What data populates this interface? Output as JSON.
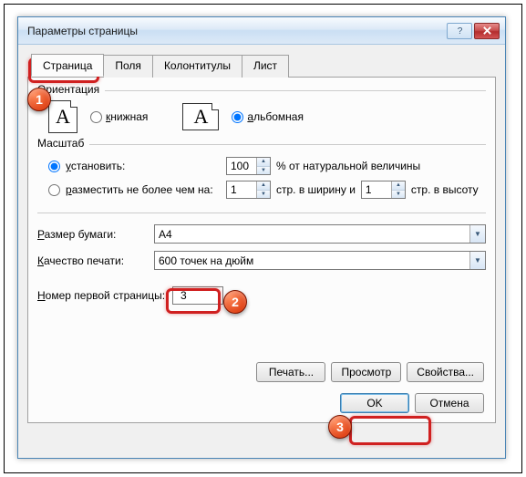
{
  "window": {
    "title": "Параметры страницы"
  },
  "tabs": [
    "Страница",
    "Поля",
    "Колонтитулы",
    "Лист"
  ],
  "orientation": {
    "legend": "Ориентация",
    "portrait": "книжная",
    "landscape": "альбомная",
    "selected": "landscape"
  },
  "scale": {
    "legend": "Масштаб",
    "set_label": "установить:",
    "set_value": "100",
    "set_suffix": "% от натуральной величины",
    "fit_label": "разместить не более чем на:",
    "fit_w": "1",
    "fit_mid": "стр. в ширину и",
    "fit_h": "1",
    "fit_suffix": "стр. в высоту",
    "selected": "set"
  },
  "paper": {
    "size_label": "Размер бумаги:",
    "size_value": "A4",
    "quality_label": "Качество печати:",
    "quality_value": "600 точек на дюйм"
  },
  "first_page": {
    "label": "Номер первой страницы:",
    "value": "3"
  },
  "buttons": {
    "print": "Печать...",
    "preview": "Просмотр",
    "properties": "Свойства...",
    "ok": "OK",
    "cancel": "Отмена"
  },
  "callouts": {
    "1": "1",
    "2": "2",
    "3": "3"
  }
}
